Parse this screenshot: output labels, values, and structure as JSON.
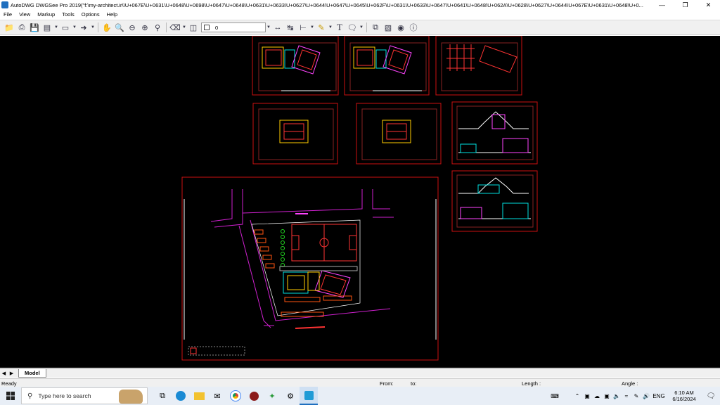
{
  "window": {
    "title": "AutoDWG DWGSee Pro 2019(\"f:\\my-architect.ir\\\\U+067E\\U+0631\\U+0648\\U+0698\\U+0647\\U+0648\\U+0631\\U+0633\\U+0627\\U+0644\\U+0647\\U+0645\\U+062F\\U+0631\\U+0633\\U+0647\\U+0641\\U+0648\\U+062A\\U+0628\\U+0627\\U+0644\\U+067E\\U+0631\\U+0648\\U+0..."
  },
  "menu": [
    "File",
    "View",
    "Markup",
    "Tools",
    "Options",
    "Help"
  ],
  "toolbar": {
    "layer_value": "0",
    "text_tool": "T"
  },
  "tabs": {
    "model_label": "Model"
  },
  "status": {
    "ready": "Ready",
    "from_label": "From:",
    "to_label": "to:",
    "length_label": "Length :",
    "angle_label": "Angle :"
  },
  "taskbar": {
    "search_placeholder": "Type here to search",
    "language": "ENG",
    "time": "6:10 AM",
    "date": "6/16/2024"
  },
  "colors": {
    "canvas_bg": "#000000",
    "sheet_border": "#cc1111",
    "road_color": "#d020d0",
    "accent": "#1f6fbf"
  }
}
